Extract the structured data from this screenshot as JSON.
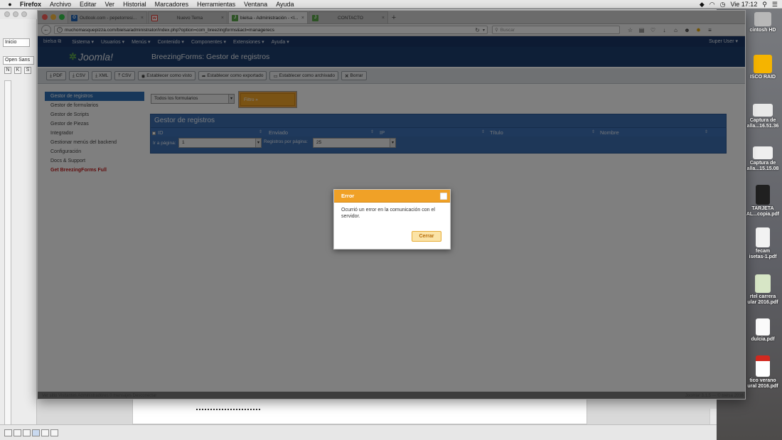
{
  "mac_menubar": {
    "app": "Firefox",
    "items": [
      "Archivo",
      "Editar",
      "Ver",
      "Historial",
      "Marcadores",
      "Herramientas",
      "Ventana",
      "Ayuda"
    ],
    "clock": "Vie 17:12"
  },
  "bg_window": {
    "home_tab": "Inicio",
    "font_field": "Open Sans",
    "style_buttons": [
      "N",
      "K",
      "S"
    ]
  },
  "desktop_icons": [
    {
      "label": "cintosh HD"
    },
    {
      "label": "ISCO RAID"
    },
    {
      "label": "Captura de\nalla...16.51.36"
    },
    {
      "label": "Captura de\nalla...15.15.08"
    },
    {
      "label": "TARJETA\nAL...copia.pdf"
    },
    {
      "label": "fecam\nisetas-1.pdf"
    },
    {
      "label": "rtel carrera\nular 2016.pdf"
    },
    {
      "label": "dulcia.pdf"
    },
    {
      "label": "tico verano\nural 2016.pdf"
    }
  ],
  "browser": {
    "tabs": [
      {
        "label": "Outlook.com - pepetorresi...",
        "icon": "outlook-icon",
        "color": "#1f62b4",
        "glyph": "O"
      },
      {
        "label": "Nuevo Tema",
        "icon": "wallapop-icon",
        "color": "#e8332b",
        "glyph": "w"
      },
      {
        "label": "bielsa - Administración - <l...",
        "icon": "joomla-icon",
        "color": "#5aa74a",
        "glyph": "J"
      },
      {
        "label": "CONTACTO",
        "icon": "joomla-icon",
        "color": "#5aa74a",
        "glyph": "J"
      }
    ],
    "url": "muchomasquepizza.com/bielsa/administrator/index.php?option=com_breezingforms&act=managerecs",
    "search_placeholder": "Buscar"
  },
  "joomla": {
    "brand": "bielsa",
    "menu": [
      "Sistema ▾",
      "Usuarios ▾",
      "Menús ▾",
      "Contenido ▾",
      "Componentes ▾",
      "Extensiones ▾",
      "Ayuda ▾"
    ],
    "user": "Super User ▾",
    "logo": "Joomla!",
    "page_title": "BreezingForms: Gestor de registros",
    "toolbar": [
      {
        "icon": "download-icon",
        "label": "PDF"
      },
      {
        "icon": "download-icon",
        "label": "CSV"
      },
      {
        "icon": "download-icon",
        "label": "XML"
      },
      {
        "icon": "upload-icon",
        "label": "CSV"
      },
      {
        "icon": "eye-icon",
        "label": "Establecer como visto"
      },
      {
        "icon": "share-icon",
        "label": "Establecer como exportado"
      },
      {
        "icon": "archive-icon",
        "label": "Establecer como archivado"
      },
      {
        "icon": "close-icon",
        "label": "Borrar"
      }
    ],
    "sidebar": [
      {
        "label": "Gestor de registros",
        "active": true
      },
      {
        "label": "Gestor de formularios"
      },
      {
        "label": "Gestor de Scripts"
      },
      {
        "label": "Gestor de Piezas"
      },
      {
        "label": "Integrador"
      },
      {
        "label": "Gestionar menús del backend"
      },
      {
        "label": "Configuración"
      },
      {
        "label": "Docs & Support"
      },
      {
        "label": "Get BreezingForms Full",
        "highlight": true
      }
    ],
    "form_filter": "Todos los formularios",
    "filter_button": "Filtro »",
    "records": {
      "title": "Gestor de registros",
      "columns": [
        "ID",
        "Enviado",
        "IP",
        "Título",
        "Nombre"
      ],
      "goto_page_label": "Ir a página:",
      "page_value": "1",
      "per_page_label": "Registros por página:",
      "per_page_value": "25"
    },
    "footer": {
      "left": "Ver sitio  Visitantes  Administradores  0 mensajes  Desconectar",
      "right": "Joomla! 3.1.5 — © bielsa 2016"
    }
  },
  "modal": {
    "title": "Error",
    "message": "Ocurrió un error en la comunicación con el servidor.",
    "close_button": "Cerrar"
  },
  "colors": {
    "joomla_nav": "#1a3766",
    "joomla_header": "#1d3e6e",
    "table_blue": "#3c6eb1",
    "modal_orange": "#f0a127",
    "sidebar_active": "#2f6fb5"
  }
}
